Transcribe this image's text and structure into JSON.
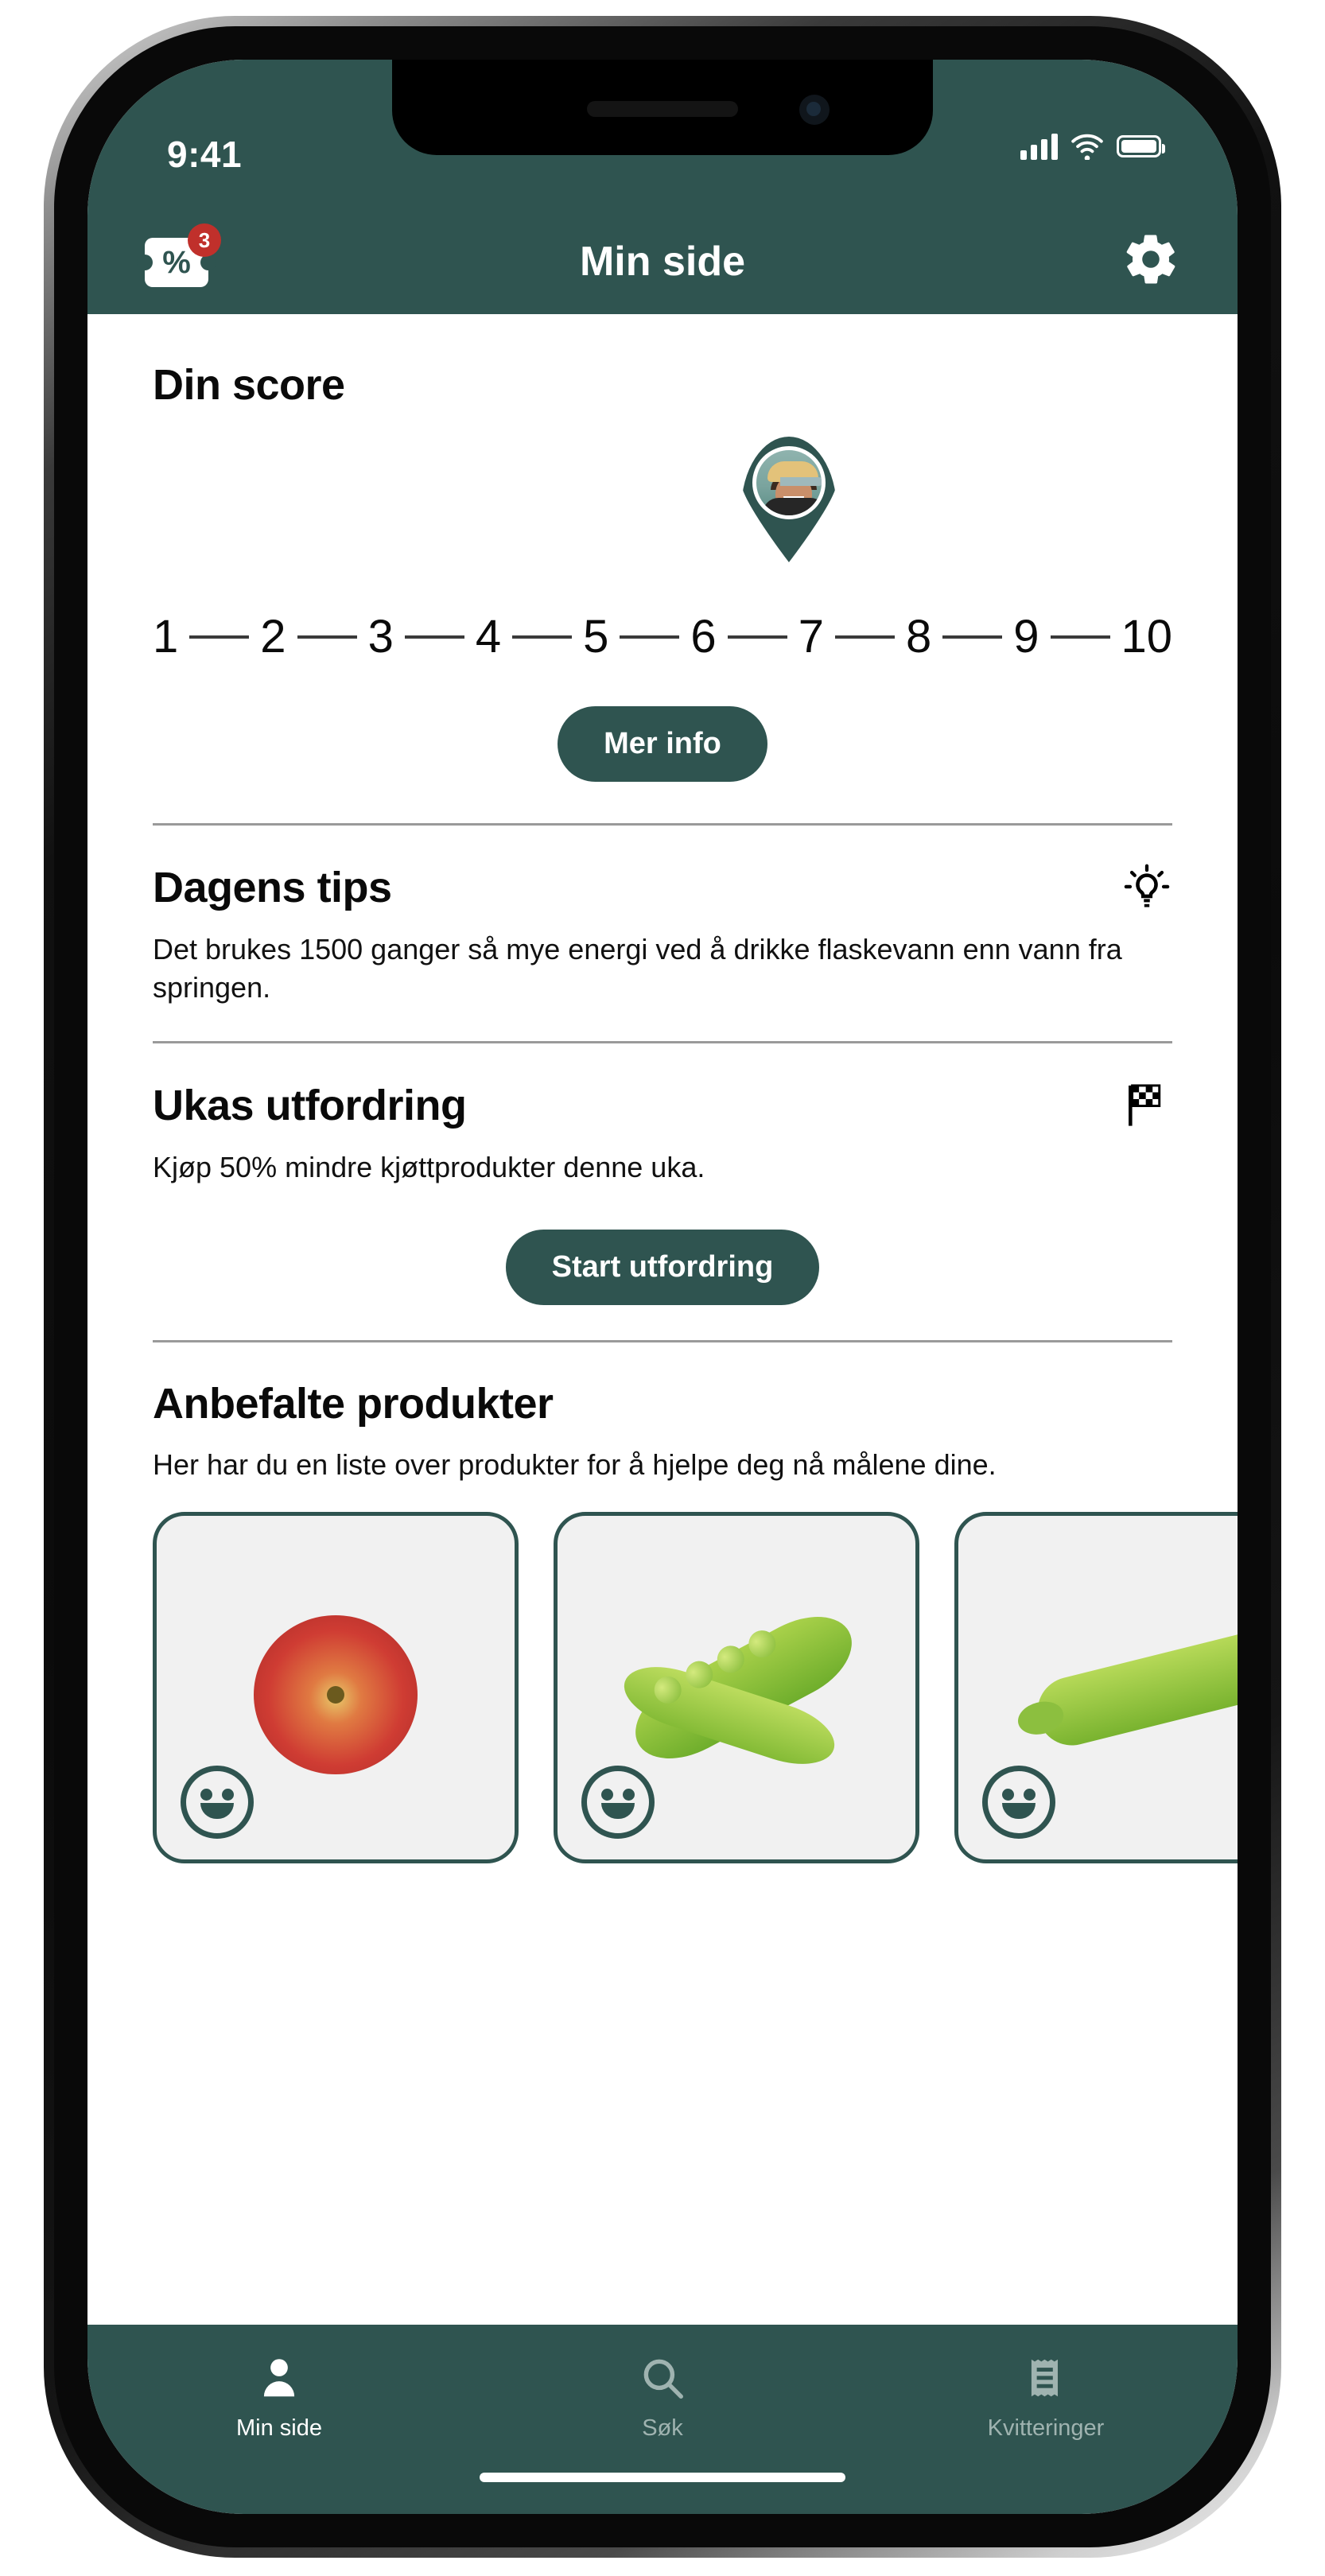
{
  "statusbar": {
    "time": "9:41",
    "signal_icon": "signal-bars-icon",
    "wifi_icon": "wifi-icon",
    "battery_icon": "battery-icon"
  },
  "navbar": {
    "title": "Min side",
    "offers_icon": "discount-ticket-icon",
    "offers_badge": "3",
    "settings_icon": "gear-icon"
  },
  "score": {
    "title": "Din score",
    "scale": [
      "1",
      "2",
      "3",
      "4",
      "5",
      "6",
      "7",
      "8",
      "9",
      "10"
    ],
    "current_value": 7.5,
    "marker_icon": "map-pin-avatar-icon",
    "button_label": "Mer info"
  },
  "tips": {
    "title": "Dagens tips",
    "icon": "lightbulb-icon",
    "body": "Det brukes 1500 ganger så mye energi ved å drikke flaskevann enn vann fra springen."
  },
  "challenge": {
    "title": "Ukas utfordring",
    "icon": "checkered-flag-icon",
    "body": "Kjøp 50% mindre kjøttprodukter denne uka.",
    "button_label": "Start utfordring"
  },
  "products": {
    "title": "Anbefalte produkter",
    "body": "Her har du en liste over produkter for å hjelpe deg nå målene dine.",
    "items": [
      {
        "name": "apple-product",
        "rating_icon": "smiley-face-icon"
      },
      {
        "name": "pea-pod-product",
        "rating_icon": "smiley-face-icon"
      },
      {
        "name": "pea-pod-product-2",
        "rating_icon": "smiley-face-icon"
      }
    ]
  },
  "tabbar": {
    "items": [
      {
        "label": "Min side",
        "icon": "person-icon",
        "active": true
      },
      {
        "label": "Søk",
        "icon": "search-icon",
        "active": false
      },
      {
        "label": "Kvitteringer",
        "icon": "receipt-icon",
        "active": false
      }
    ]
  },
  "colors": {
    "brand_green": "#2f5450",
    "badge_red": "#c0302b",
    "inactive_tab": "#9fb3b0"
  }
}
